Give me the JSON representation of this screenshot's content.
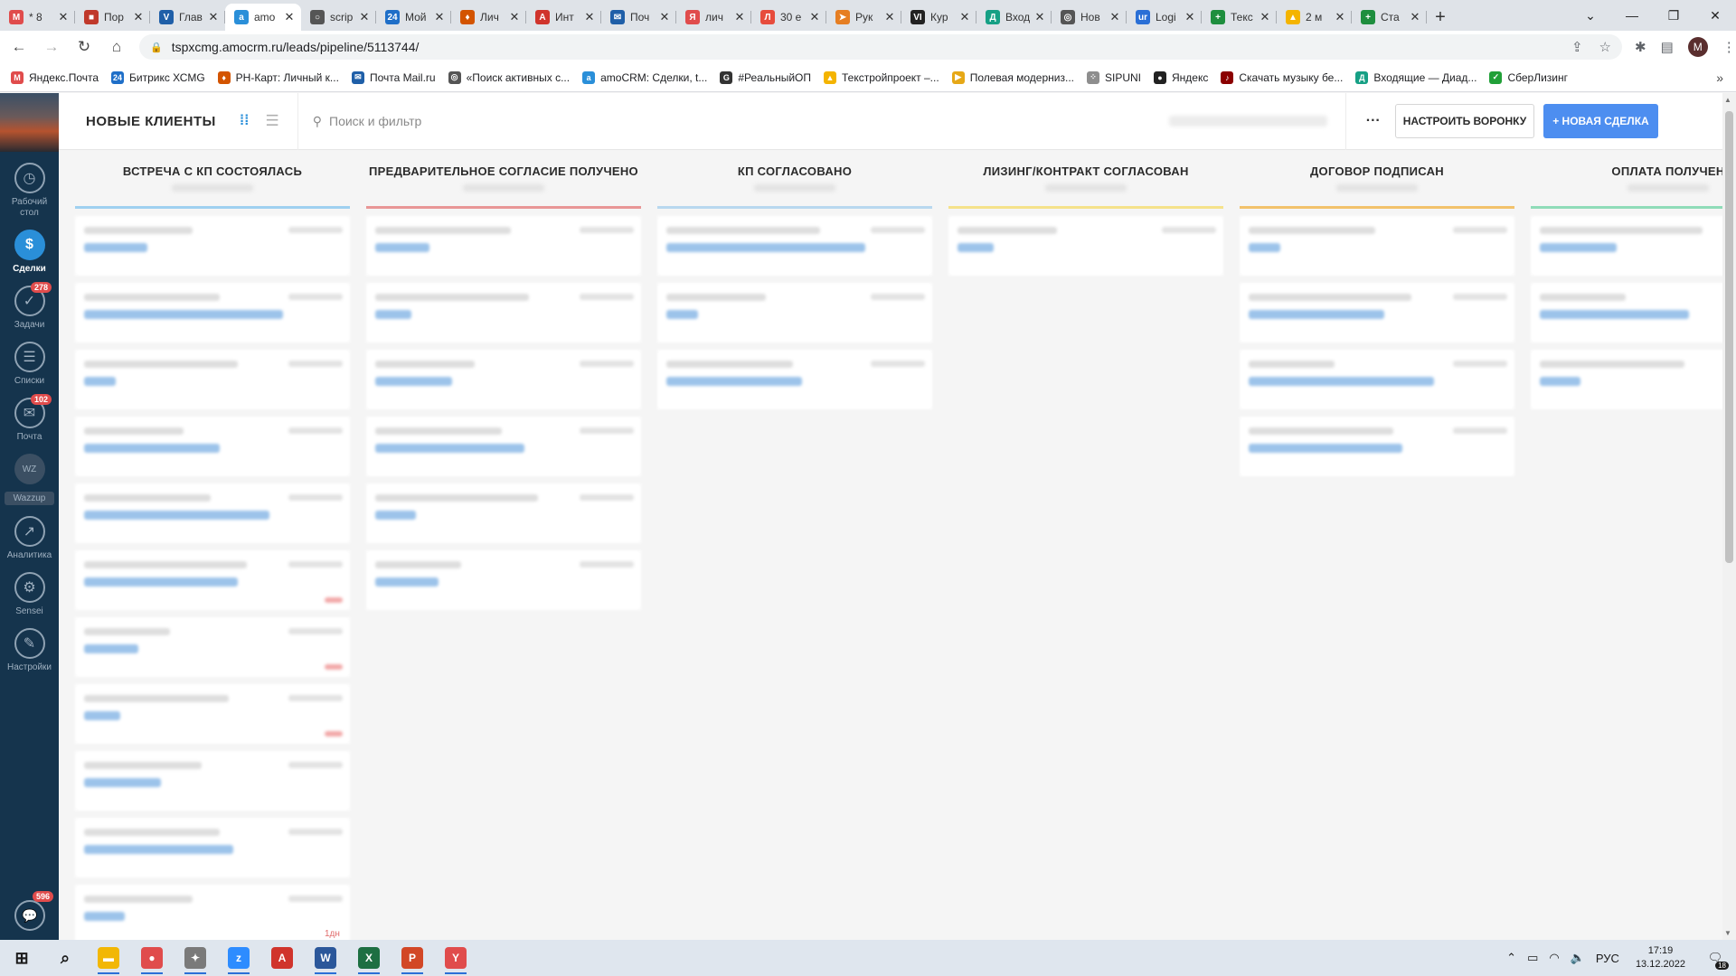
{
  "browser": {
    "tabs": [
      {
        "label": "* 8",
        "color": "#e04c4c",
        "glyph": "M"
      },
      {
        "label": "Пор",
        "color": "#c0392b",
        "glyph": "■"
      },
      {
        "label": "Глав",
        "color": "#1f5fa8",
        "glyph": "V"
      },
      {
        "label": "amo",
        "color": "#2a8fd9",
        "glyph": "a",
        "active": true
      },
      {
        "label": "scrip",
        "color": "#555555",
        "glyph": "○"
      },
      {
        "label": "Мой",
        "color": "#1f6fc8",
        "glyph": "24"
      },
      {
        "label": "Лич",
        "color": "#d35400",
        "glyph": "♦"
      },
      {
        "label": "Инт",
        "color": "#d0342c",
        "glyph": "A"
      },
      {
        "label": "Поч",
        "color": "#1f5fa8",
        "glyph": "✉"
      },
      {
        "label": "лич",
        "color": "#e04c4c",
        "glyph": "Я"
      },
      {
        "label": "30 е",
        "color": "#e74c3c",
        "glyph": "Л"
      },
      {
        "label": "Рук",
        "color": "#e67e22",
        "glyph": "➤"
      },
      {
        "label": "Кур",
        "color": "#222222",
        "glyph": "VIP"
      },
      {
        "label": "Вход",
        "color": "#16a085",
        "glyph": "Д"
      },
      {
        "label": "Нов",
        "color": "#555555",
        "glyph": "◎"
      },
      {
        "label": "Logi",
        "color": "#2a6fd6",
        "glyph": "url"
      },
      {
        "label": "Текс",
        "color": "#1e8e3e",
        "glyph": "+"
      },
      {
        "label": "2 м",
        "color": "#f4b400",
        "glyph": "▲"
      },
      {
        "label": "Ста",
        "color": "#1e8e3e",
        "glyph": "+"
      }
    ],
    "url": "tspxcmg.amocrm.ru/leads/pipeline/5113744/",
    "bookmarks": [
      {
        "label": "Яндекс.Почта",
        "color": "#e04c4c",
        "glyph": "M"
      },
      {
        "label": "Битрикс ХСМG",
        "color": "#1f6fc8",
        "glyph": "24"
      },
      {
        "label": "РН-Карт: Личный к...",
        "color": "#d35400",
        "glyph": "♦"
      },
      {
        "label": "Почта Mail.ru",
        "color": "#1f5fa8",
        "glyph": "✉"
      },
      {
        "label": "«Поиск активных с...",
        "color": "#555555",
        "glyph": "◎"
      },
      {
        "label": "amoCRM: Сделки, t...",
        "color": "#2a8fd9",
        "glyph": "a"
      },
      {
        "label": "#РеальныйОП",
        "color": "#333333",
        "glyph": "G"
      },
      {
        "label": "Текстройпроект –...",
        "color": "#f4b400",
        "glyph": "▲"
      },
      {
        "label": "Полевая модерниз...",
        "color": "#e6a817",
        "glyph": "▶"
      },
      {
        "label": "SIPUNI",
        "color": "#8e8e8e",
        "glyph": "⁘"
      },
      {
        "label": "Яндекс",
        "color": "#222222",
        "glyph": "●"
      },
      {
        "label": "Скачать музыку бе...",
        "color": "#8b0000",
        "glyph": "♪"
      },
      {
        "label": "Входящие — Диад...",
        "color": "#16a085",
        "glyph": "Д"
      },
      {
        "label": "СберЛизинг",
        "color": "#21a038",
        "glyph": "✓"
      }
    ],
    "profile_initial": "M"
  },
  "leftnav": {
    "items": [
      {
        "label": "Рабочий стол",
        "icon": "dashboard-icon",
        "glyph": "◷"
      },
      {
        "label": "Сделки",
        "icon": "deals-icon",
        "glyph": "$",
        "active": true
      },
      {
        "label": "Задачи",
        "icon": "tasks-icon",
        "glyph": "✓",
        "badge": "278"
      },
      {
        "label": "Списки",
        "icon": "lists-icon",
        "glyph": "☰"
      },
      {
        "label": "Почта",
        "icon": "mail-icon",
        "glyph": "✉",
        "badge": "102"
      },
      {
        "label": "",
        "icon": "wazzup-icon",
        "glyph": "WZ",
        "extra": "Wazzup"
      },
      {
        "label": "Аналитика",
        "icon": "analytics-icon",
        "glyph": "↗"
      },
      {
        "label": "Sensei",
        "icon": "sensei-icon",
        "glyph": "⚙"
      },
      {
        "label": "Настройки",
        "icon": "settings-icon",
        "glyph": "✎"
      }
    ],
    "chat_badge": "596"
  },
  "topbar": {
    "title": "НОВЫЕ КЛИЕНТЫ",
    "search_placeholder": "Поиск и фильтр",
    "more": "···",
    "setup_label": "НАСТРОИТЬ ВОРОНКУ",
    "new_label": "+ НОВАЯ СДЕЛКА"
  },
  "columns": [
    {
      "title": "ВСТРЕЧА С КП СОСТОЯЛАСЬ",
      "color": "#9fd0f0",
      "cards": 11,
      "footer": "1дн"
    },
    {
      "title": "ПРЕДВАРИТЕЛЬНОЕ СОГЛАСИЕ ПОЛУЧЕНО",
      "color": "#e89696",
      "cards": 6
    },
    {
      "title": "КП СОГЛАСОВАНО",
      "color": "#b8d8ef",
      "cards": 3
    },
    {
      "title": "ЛИЗИНГ/КОНТРАКТ СОГЛАСОВАН",
      "color": "#f5e28a",
      "cards": 1
    },
    {
      "title": "ДОГОВОР ПОДПИСАН",
      "color": "#f2c26b",
      "cards": 4
    },
    {
      "title": "ОПЛАТА ПОЛУЧЕН",
      "color": "#8fdcb8",
      "cards": 3
    }
  ],
  "taskbar": {
    "apps": [
      {
        "name": "start-button",
        "glyph": "⊞",
        "color": "transparent"
      },
      {
        "name": "search-taskbar-icon",
        "glyph": "⌕",
        "color": "transparent"
      },
      {
        "name": "file-explorer-icon",
        "glyph": "▬",
        "color": "#f2b705",
        "open": true
      },
      {
        "name": "chrome-icon",
        "glyph": "●",
        "color": "#e04c4c",
        "open": true
      },
      {
        "name": "app-icon",
        "glyph": "✦",
        "color": "#7a7a7a",
        "open": true
      },
      {
        "name": "zoom-icon",
        "glyph": "z",
        "color": "#2d8cff",
        "open": true
      },
      {
        "name": "acrobat-icon",
        "glyph": "A",
        "color": "#d0342c"
      },
      {
        "name": "word-icon",
        "glyph": "W",
        "color": "#2b579a",
        "open": true
      },
      {
        "name": "excel-icon",
        "glyph": "X",
        "color": "#1d6f42",
        "open": true
      },
      {
        "name": "powerpoint-icon",
        "glyph": "P",
        "color": "#d24726",
        "open": true
      },
      {
        "name": "yandex-icon",
        "glyph": "Y",
        "color": "#e04c4c",
        "open": true
      }
    ],
    "lang": "РУС",
    "time": "17:19",
    "date": "13.12.2022",
    "notif_count": "18"
  }
}
